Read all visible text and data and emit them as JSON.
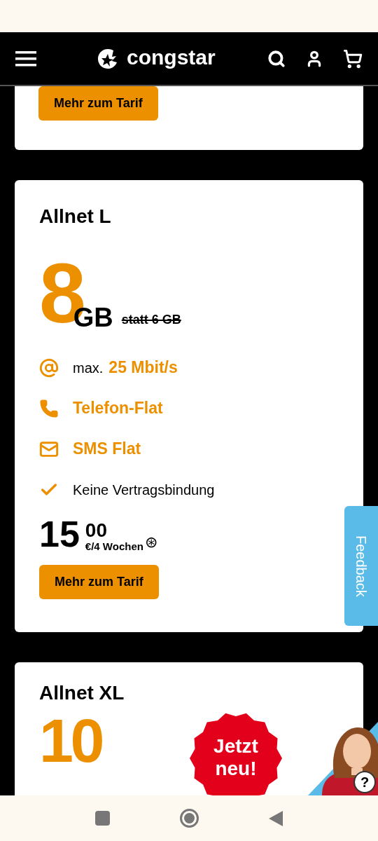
{
  "header": {
    "brand": "congstar"
  },
  "cards": [
    {
      "kind": "tail",
      "button": "Mehr zum Tarif"
    },
    {
      "kind": "full",
      "title": "Allnet L",
      "volume": "8",
      "unit": "GB",
      "old_volume": "statt 6 GB",
      "features": [
        {
          "kind": "speed",
          "prefix": "max.",
          "text": "25 Mbit/s",
          "emphasis": true
        },
        {
          "kind": "phone",
          "text": "Telefon-Flat",
          "emphasis": true
        },
        {
          "kind": "sms",
          "text": "SMS Flat",
          "emphasis": true
        },
        {
          "kind": "check",
          "text": "Keine Vertragsbindung",
          "emphasis": false
        }
      ],
      "price": "15",
      "cents": "00",
      "period": "€/4 Wochen",
      "footnote": "⊛",
      "button": "Mehr zum Tarif"
    },
    {
      "kind": "head",
      "title": "Allnet XL",
      "volume": "10"
    }
  ],
  "feedback_tab": "Feedback",
  "new_badge": [
    "Jetzt",
    "neu!"
  ],
  "help_button": "?"
}
